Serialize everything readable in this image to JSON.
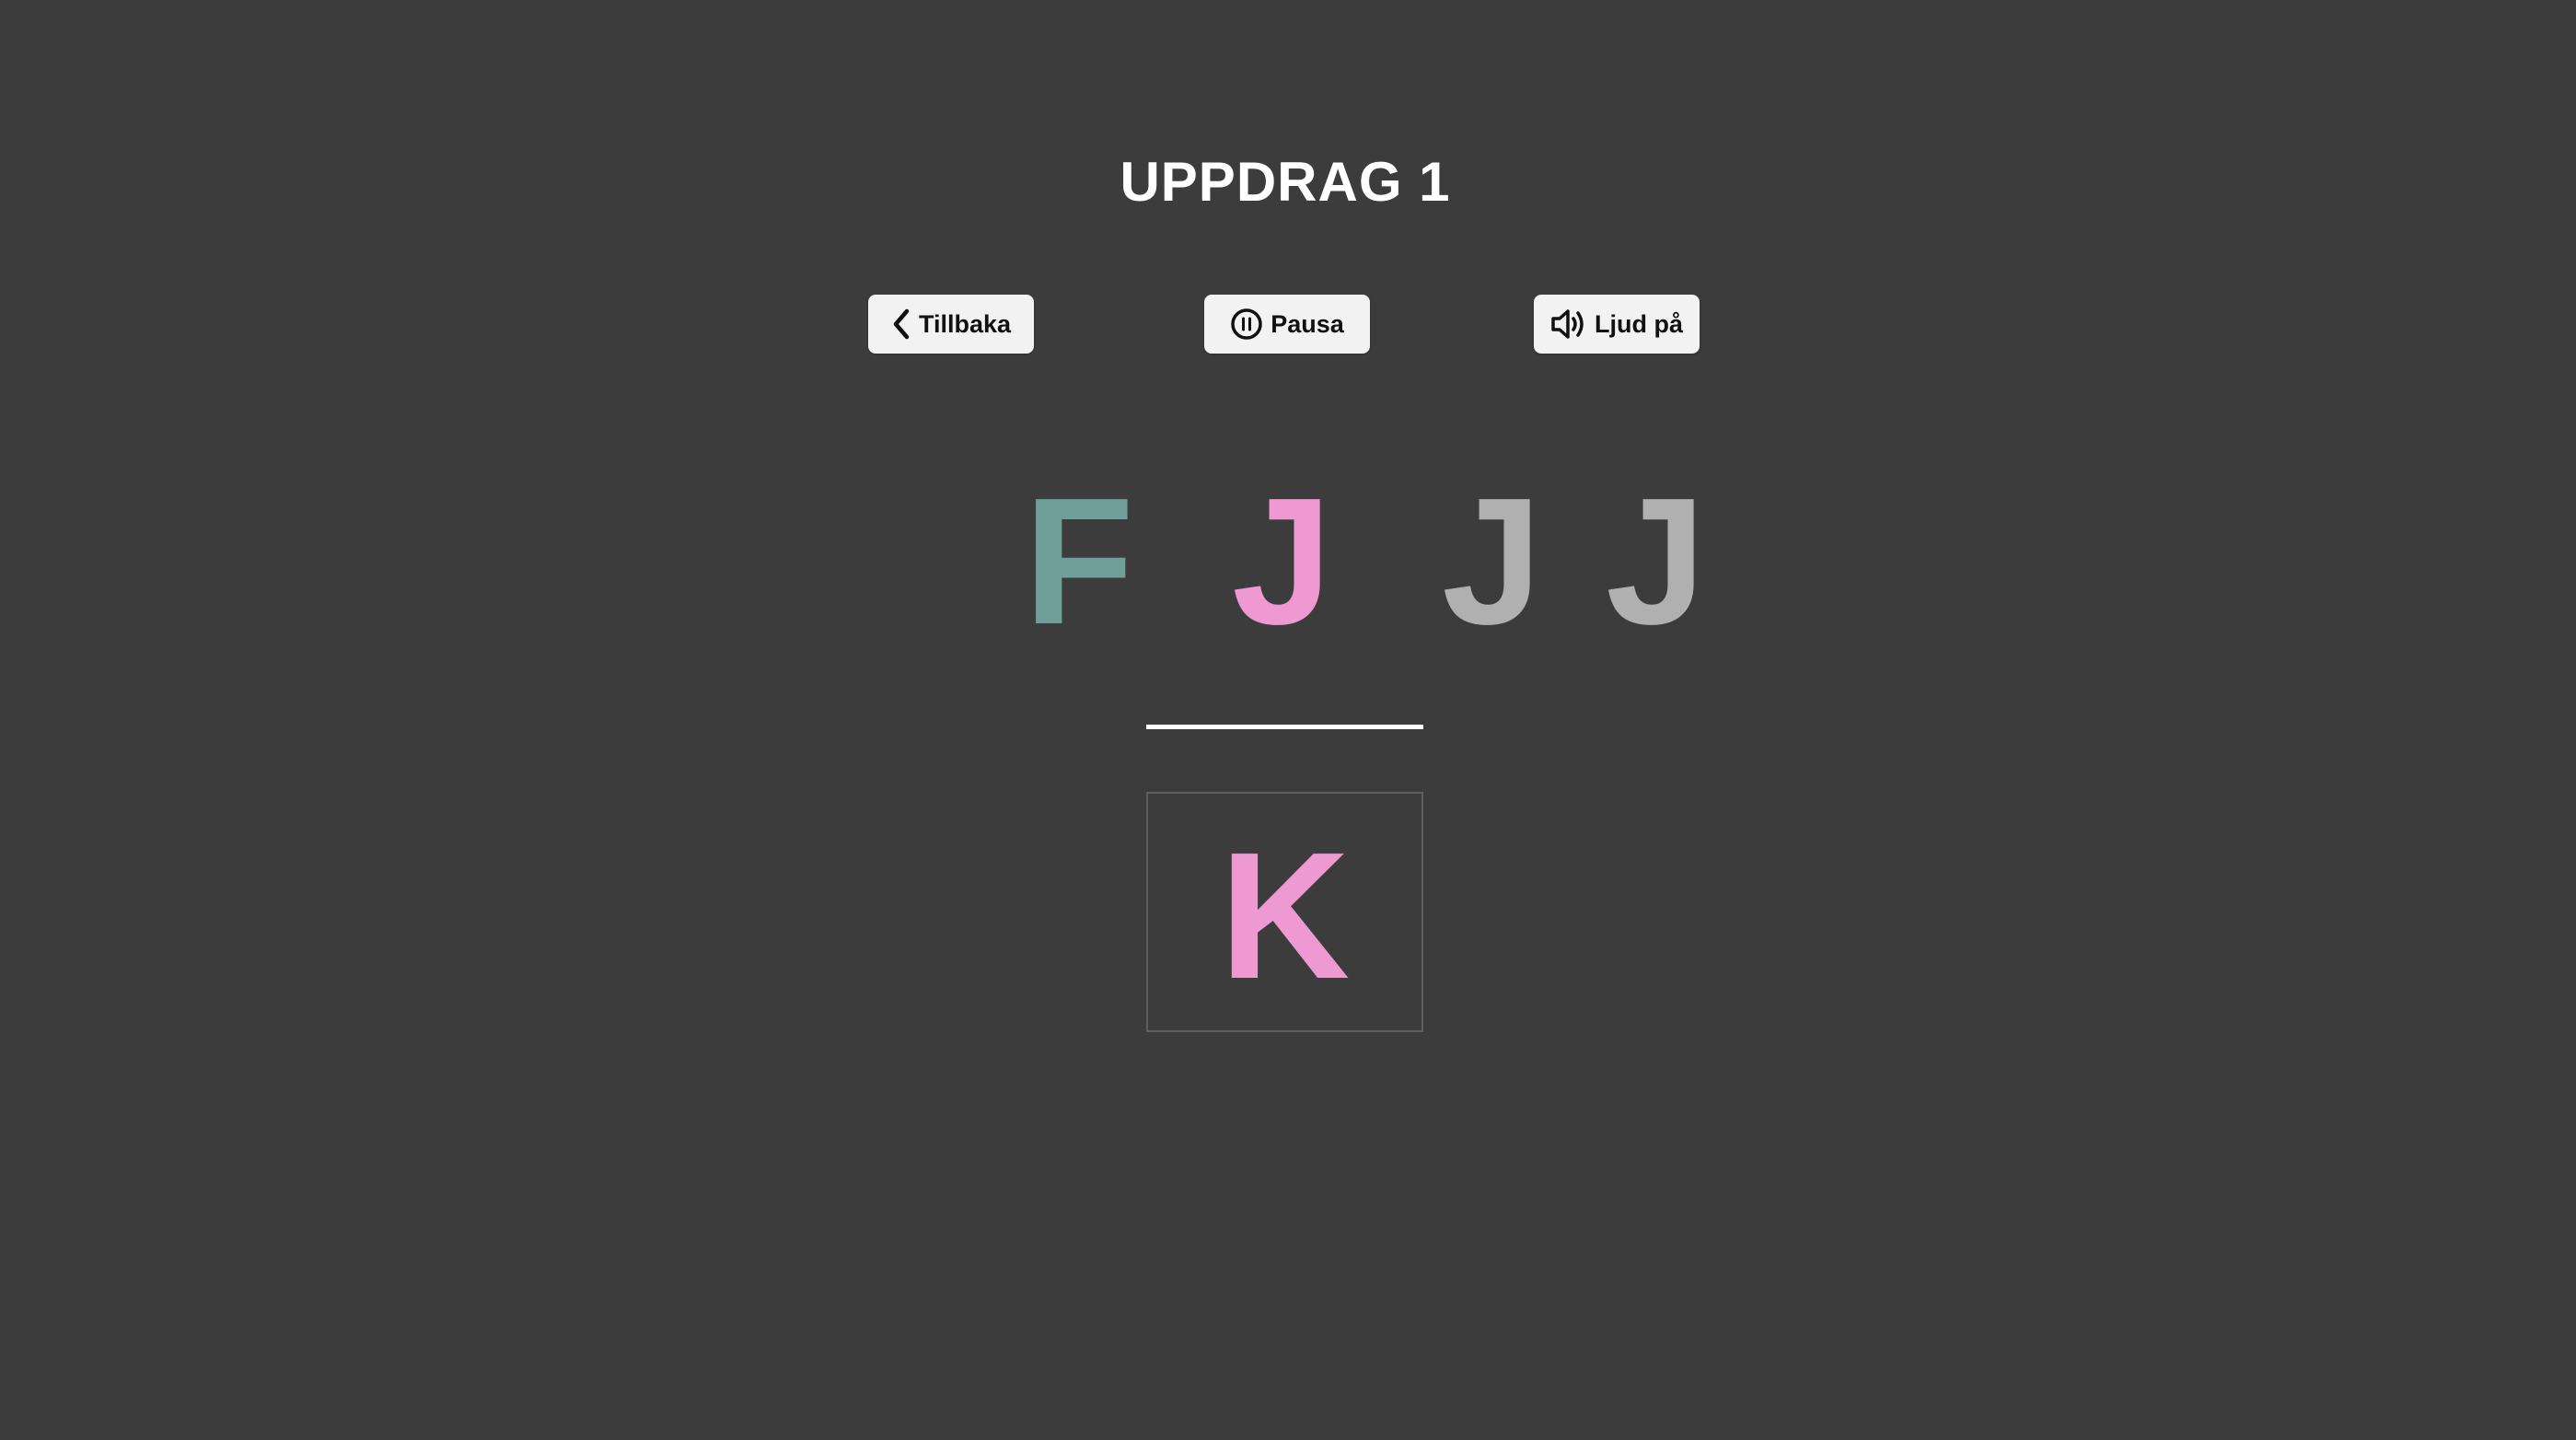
{
  "page": {
    "title": "UPPDRAG 1",
    "background": "#3c3c3c"
  },
  "toolbar": {
    "back": {
      "label": "Tillbaka",
      "icon": "chevron-left-icon"
    },
    "pause": {
      "label": "Pausa",
      "icon": "pause-circle-icon"
    },
    "sound": {
      "label": "Ljud på",
      "icon": "speaker-icon"
    }
  },
  "sequence": {
    "letters": [
      {
        "char": "F",
        "color": "#6f9f98"
      },
      {
        "char": "J",
        "color": "#ee99d2"
      },
      {
        "char": "J",
        "color": "#b0b0b0"
      },
      {
        "char": "J",
        "color": "#b0b0b0"
      }
    ]
  },
  "answer": {
    "char": "K",
    "color": "#ee99d2"
  }
}
